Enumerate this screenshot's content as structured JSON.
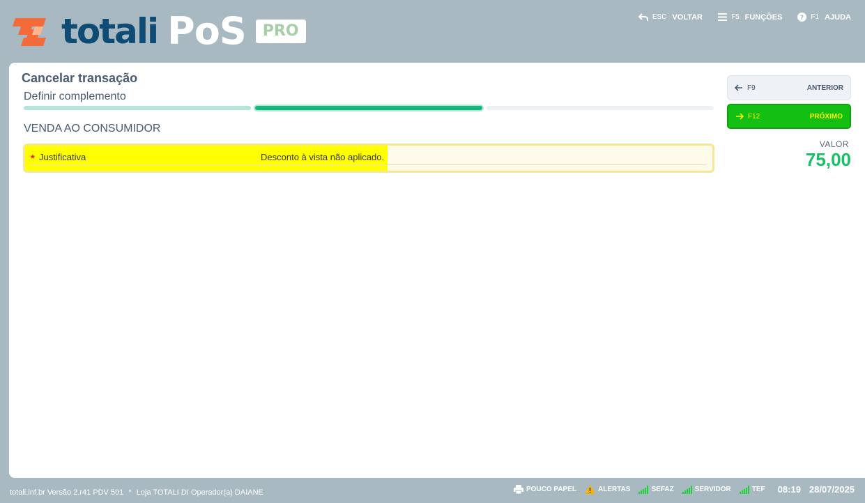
{
  "brand": {
    "name": "totali",
    "product": "PoS",
    "edition": "PRO",
    "colors": {
      "primary": "#0f4c75",
      "mark": "#f36b3b",
      "accent_green": "#17b57a",
      "next_button": "#12bf12"
    }
  },
  "top_menu": [
    {
      "key": "ESC",
      "label": "VOLTAR",
      "icon": "undo-arrow-icon"
    },
    {
      "key": "F5",
      "label": "FUNÇÕES",
      "icon": "menu-icon"
    },
    {
      "key": "F1",
      "label": "AJUDA",
      "icon": "help-icon"
    }
  ],
  "page": {
    "title": "Cancelar transação",
    "step_title": "Definir complemento",
    "progress": {
      "total_steps": 3,
      "current_step": 2
    },
    "section_title": "VENDA AO CONSUMIDOR"
  },
  "form": {
    "justificativa": {
      "required_mark": "*",
      "label": "Justificativa",
      "value": "Desconto à vista não aplicado."
    }
  },
  "side_panel": {
    "prev": {
      "key": "F9",
      "label": "ANTERIOR",
      "icon": "arrow-left-icon"
    },
    "next": {
      "key": "F12",
      "label": "PRÓXIMO",
      "icon": "arrow-right-icon"
    },
    "valor_label": "VALOR",
    "valor_value": "75,00"
  },
  "footer": {
    "site": "totali.inf.br",
    "version": "Versão 2.r41",
    "pdv": "PDV 501",
    "separator": "*",
    "store": "Loja TOTALI DI",
    "operator": "Operador(a) DAIANE",
    "status": [
      {
        "label": "POUCO PAPEL",
        "icon": "printer-icon"
      },
      {
        "label": "ALERTAS",
        "icon": "warning-icon"
      },
      {
        "label": "SEFAZ",
        "icon": "signal-icon"
      },
      {
        "label": "SERVIDOR",
        "icon": "signal-icon"
      },
      {
        "label": "TEF",
        "icon": "signal-icon"
      }
    ],
    "time": "08:19",
    "date": "28/07/2025"
  }
}
